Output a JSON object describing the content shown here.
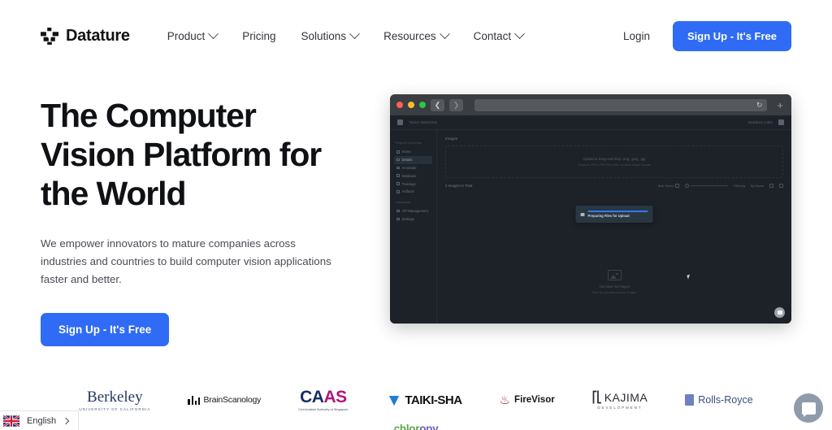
{
  "brand": {
    "name": "Datature",
    "logo_icon": "datature-logo-mark"
  },
  "nav": {
    "items": [
      {
        "label": "Product",
        "has_dropdown": true
      },
      {
        "label": "Pricing",
        "has_dropdown": false
      },
      {
        "label": "Solutions",
        "has_dropdown": true
      },
      {
        "label": "Resources",
        "has_dropdown": true
      },
      {
        "label": "Contact",
        "has_dropdown": true
      }
    ],
    "login_label": "Login",
    "signup_label": "Sign Up - It's Free"
  },
  "hero": {
    "title": "The Computer Vision Platform for the World",
    "subtitle": "We empower innovators to mature companies across industries and countries to build computer vision applications faster and better.",
    "cta_label": "Sign Up - It's Free"
  },
  "mockup": {
    "window_dots": [
      "#ff5f57",
      "#febc2e",
      "#28c840"
    ],
    "back_icon": "chevron-left-icon",
    "forward_icon": "chevron-right-icon",
    "reload_icon": "reload-icon",
    "newtab_icon": "plus-icon",
    "app_title": "Tumor Detection",
    "account_label": "Datature Labs",
    "sidebar_group_1": "Project Overview",
    "sidebar_items": [
      "Home",
      "Details",
      "Annotator",
      "Database",
      "Trainings",
      "Artifacts"
    ],
    "sidebar_active": "Details",
    "sidebar_group_2": "Advanced",
    "sidebar_items_2": [
      "API Management",
      "Settings"
    ],
    "content_heading": "Images",
    "dropzone_title": "Upload or Drag-and-Drop .png, .jpeg, .jpg",
    "dropzone_sub": "Supports JPEG, PNG and other common image formats",
    "total_label": "0 Images In Total",
    "toolbar_bulk": "Bulk Select",
    "toolbar_search": "Search",
    "toolbar_filter": "Filtering",
    "toolbar_sort": "By Name",
    "toast_text": "Preparing Files for Upload",
    "empty_title": "You have no images",
    "empty_sub": "Start by uploading some images",
    "chat_icon": "chat-bubble-icon"
  },
  "logos": {
    "berkeley": {
      "name": "Berkeley",
      "sub": "UNIVERSITY OF CALIFORNIA"
    },
    "brainscanology": {
      "name": "BrainScanology"
    },
    "caas": {
      "part1": "CA",
      "part2": "AS",
      "sub": "Civil Aviation Authority of Singapore"
    },
    "taikisha": {
      "name": "TAIKI-SHA"
    },
    "firevisor": {
      "name": "FireVisor"
    },
    "kajima": {
      "name": "KAJIMA",
      "sub": "DEVELOPMENT"
    },
    "rollsroyce": {
      "name": "Rolls-Royce"
    },
    "chloropy": {
      "part1": "chlor",
      "part2": "opy"
    }
  },
  "overlays": {
    "language_label": "English",
    "language_flag_icon": "uk-flag-icon",
    "language_chevron_icon": "chevron-right-icon",
    "chat_icon": "chat-bubble-icon"
  }
}
